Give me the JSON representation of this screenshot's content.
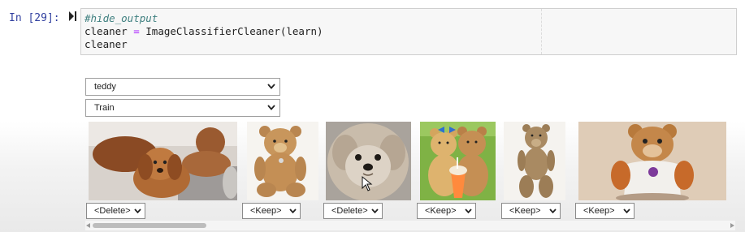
{
  "cell": {
    "prompt": "In [29]:",
    "code": {
      "comment": "#hide_output",
      "line2_var": "cleaner",
      "line2_op": "=",
      "line2_call": "ImageClassifierCleaner(learn)",
      "line3": "cleaner"
    }
  },
  "widget": {
    "category_dropdown": {
      "value": "teddy"
    },
    "split_dropdown": {
      "value": "Train"
    },
    "images": [
      {
        "icon": "puppies-image",
        "action": "<Delete>"
      },
      {
        "icon": "teddy-bear-image",
        "action": "<Keep>"
      },
      {
        "icon": "fluffy-dog-image",
        "action": "<Delete>"
      },
      {
        "icon": "two-teddy-bears-image",
        "action": "<Keep>"
      },
      {
        "icon": "vintage-teddy-bear-image",
        "action": "<Keep>"
      },
      {
        "icon": "teddy-ruxpin-image",
        "action": "<Keep>"
      }
    ]
  },
  "colors": {
    "prompt_blue": "#303f9f",
    "comment_teal": "#408080",
    "operator_purple": "#aa22ff",
    "cell_bg": "#f7f7f7"
  }
}
